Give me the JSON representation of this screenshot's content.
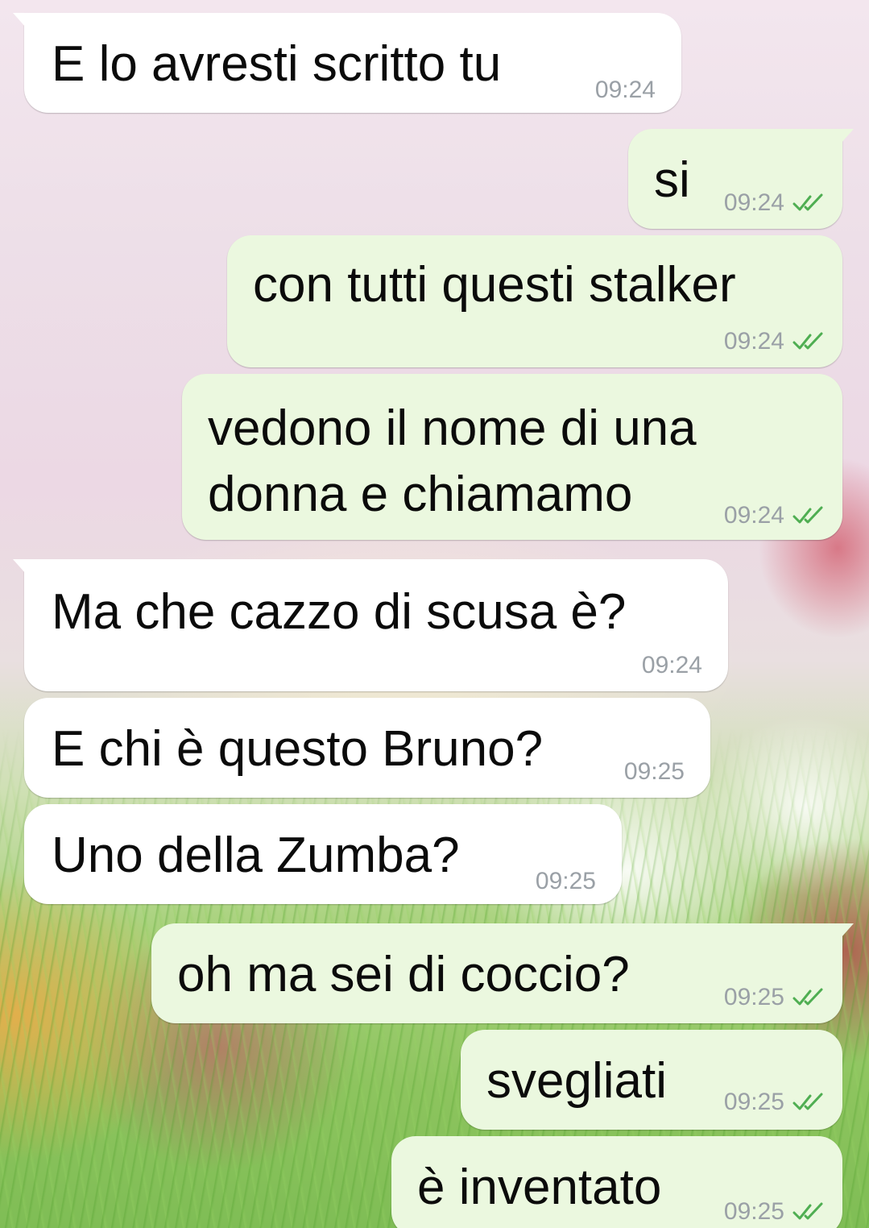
{
  "colors": {
    "incoming_bubble": "#ffffff",
    "outgoing_bubble": "#ebf8df",
    "timestamp": "#9aa0a6",
    "read_tick": "#4fae52"
  },
  "messages": [
    {
      "direction": "in",
      "text": "E lo avresti scritto tu",
      "time": "09:24"
    },
    {
      "direction": "out",
      "text": "si",
      "time": "09:24",
      "status": "read-double-tick-icon"
    },
    {
      "direction": "out",
      "text": "con tutti questi stalker",
      "time": "09:24",
      "status": "read-double-tick-icon"
    },
    {
      "direction": "out",
      "text_line1": "vedono il nome di una",
      "text_line2": "donna e chiamamo",
      "time": "09:24",
      "status": "read-double-tick-icon"
    },
    {
      "direction": "in",
      "text": "Ma che cazzo di scusa è?",
      "time": "09:24"
    },
    {
      "direction": "in",
      "text": "E chi è questo Bruno?",
      "time": "09:25"
    },
    {
      "direction": "in",
      "text": "Uno della Zumba?",
      "time": "09:25"
    },
    {
      "direction": "out",
      "text": "oh ma sei di coccio?",
      "time": "09:25",
      "status": "read-double-tick-icon"
    },
    {
      "direction": "out",
      "text": "svegliati",
      "time": "09:25",
      "status": "read-double-tick-icon"
    },
    {
      "direction": "out",
      "text": "è inventato",
      "time": "09:25",
      "status": "read-double-tick-icon"
    }
  ]
}
